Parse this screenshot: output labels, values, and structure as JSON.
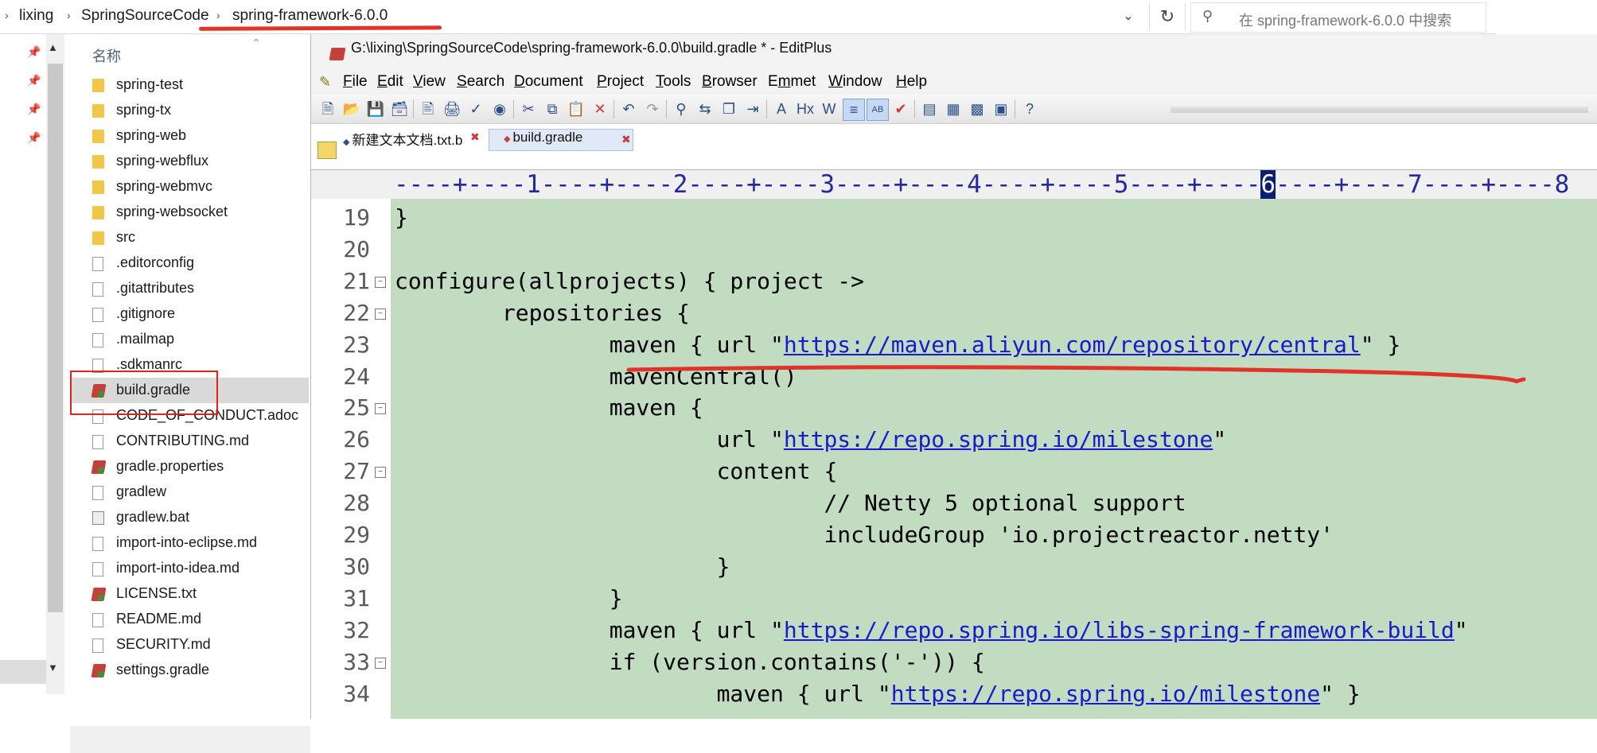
{
  "address_bar": {
    "crumbs": [
      "lixing",
      "SpringSourceCode",
      "spring-framework-6.0.0"
    ],
    "search_placeholder": "在 spring-framework-6.0.0 中搜索"
  },
  "file_list": {
    "column_header": "名称",
    "items": [
      {
        "name": "spring-test",
        "type": "folder"
      },
      {
        "name": "spring-tx",
        "type": "folder"
      },
      {
        "name": "spring-web",
        "type": "folder"
      },
      {
        "name": "spring-webflux",
        "type": "folder"
      },
      {
        "name": "spring-webmvc",
        "type": "folder"
      },
      {
        "name": "spring-websocket",
        "type": "folder"
      },
      {
        "name": "src",
        "type": "folder"
      },
      {
        "name": ".editorconfig",
        "type": "file"
      },
      {
        "name": ".gitattributes",
        "type": "file"
      },
      {
        "name": ".gitignore",
        "type": "file"
      },
      {
        "name": ".mailmap",
        "type": "file"
      },
      {
        "name": ".sdkmanrc",
        "type": "file"
      },
      {
        "name": "build.gradle",
        "type": "gradle",
        "selected": true
      },
      {
        "name": "CODE_OF_CONDUCT.adoc",
        "type": "file"
      },
      {
        "name": "CONTRIBUTING.md",
        "type": "file"
      },
      {
        "name": "gradle.properties",
        "type": "gradle"
      },
      {
        "name": "gradlew",
        "type": "file"
      },
      {
        "name": "gradlew.bat",
        "type": "bat"
      },
      {
        "name": "import-into-eclipse.md",
        "type": "file"
      },
      {
        "name": "import-into-idea.md",
        "type": "file"
      },
      {
        "name": "LICENSE.txt",
        "type": "gradle"
      },
      {
        "name": "README.md",
        "type": "file"
      },
      {
        "name": "SECURITY.md",
        "type": "file"
      },
      {
        "name": "settings.gradle",
        "type": "gradle"
      }
    ]
  },
  "editor": {
    "title": "G:\\lixing\\SpringSourceCode\\spring-framework-6.0.0\\build.gradle * - EditPlus",
    "menu": [
      {
        "label": "File",
        "key": "F",
        "rest": "ile"
      },
      {
        "label": "Edit",
        "key": "E",
        "rest": "dit"
      },
      {
        "label": "View",
        "key": "V",
        "rest": "iew"
      },
      {
        "label": "Search",
        "key": "S",
        "rest": "earch"
      },
      {
        "label": "Document",
        "key": "D",
        "rest": "ocument"
      },
      {
        "label": "Project",
        "key": "P",
        "rest": "roject"
      },
      {
        "label": "Tools",
        "key": "T",
        "rest": "ools"
      },
      {
        "label": "Browser",
        "key": "B",
        "rest": "rowser"
      },
      {
        "label": "Emmet",
        "key": "m",
        "pre": "E",
        "rest": "met"
      },
      {
        "label": "Window",
        "key": "W",
        "rest": "indow"
      },
      {
        "label": "Help",
        "key": "H",
        "rest": "elp"
      }
    ],
    "tabs": [
      {
        "label": "新建文本文档.txt.b",
        "active": false
      },
      {
        "label": "build.gradle",
        "active": true
      }
    ],
    "ruler": {
      "before": "----+----1----+----2----+----3----+----4----+----5----+----",
      "current": "6",
      "after": "----+----7----+----8"
    },
    "lines": [
      {
        "n": "19",
        "fold": false,
        "text": "}",
        "link": ""
      },
      {
        "n": "20",
        "fold": false,
        "text": "",
        "link": ""
      },
      {
        "n": "21",
        "fold": true,
        "text": "configure(allprojects) { project ->",
        "link": ""
      },
      {
        "n": "22",
        "fold": true,
        "text": "        repositories {",
        "link": ""
      },
      {
        "n": "23",
        "fold": false,
        "text": "                maven { url \"",
        "link": "https://maven.aliyun.com/repository/central",
        "tail": "\" }"
      },
      {
        "n": "24",
        "fold": false,
        "text": "                mavenCentral()",
        "link": ""
      },
      {
        "n": "25",
        "fold": true,
        "text": "                maven {",
        "link": ""
      },
      {
        "n": "26",
        "fold": false,
        "text": "                        url \"",
        "link": "https://repo.spring.io/milestone",
        "tail": "\""
      },
      {
        "n": "27",
        "fold": true,
        "text": "                        content {",
        "link": ""
      },
      {
        "n": "28",
        "fold": false,
        "text": "                                // Netty 5 optional support",
        "link": ""
      },
      {
        "n": "29",
        "fold": false,
        "text": "                                includeGroup 'io.projectreactor.netty'",
        "link": ""
      },
      {
        "n": "30",
        "fold": false,
        "text": "                        }",
        "link": ""
      },
      {
        "n": "31",
        "fold": false,
        "text": "                }",
        "link": ""
      },
      {
        "n": "32",
        "fold": false,
        "text": "                maven { url \"",
        "link": "https://repo.spring.io/libs-spring-framework-build",
        "tail": "\""
      },
      {
        "n": "33",
        "fold": true,
        "text": "                if (version.contains('-')) {",
        "link": ""
      },
      {
        "n": "34",
        "fold": false,
        "text": "                        maven { url \"",
        "link": "https://repo.spring.io/milestone",
        "tail": "\" }"
      }
    ]
  },
  "colors": {
    "code_background": "#c1dcc1",
    "annotation_red": "#e0342a",
    "link_blue": "#1a1acc"
  }
}
